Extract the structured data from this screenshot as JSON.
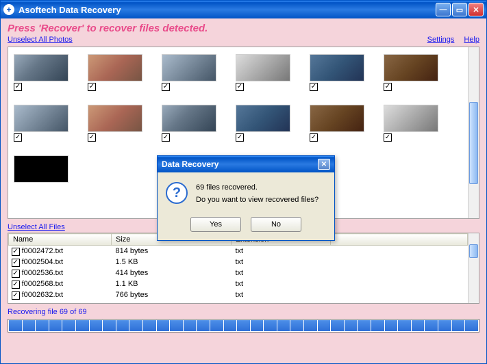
{
  "window": {
    "title": "Asoftech Data Recovery"
  },
  "instruction": "Press 'Recover' to recover files detected.",
  "links": {
    "unselect_photos": "Unselect All Photos",
    "settings": "Settings",
    "help": "Help",
    "unselect_files": "Unselect All Files"
  },
  "dialog": {
    "title": "Data Recovery",
    "line1": "69 files recovered.",
    "line2": "Do you want to view recovered files?",
    "yes": "Yes",
    "no": "No"
  },
  "file_table": {
    "cols": {
      "name": "Name",
      "size": "Size",
      "ext": "Extension"
    },
    "rows": [
      {
        "name": "f0002472.txt",
        "size": "814 bytes",
        "ext": "txt"
      },
      {
        "name": "f0002504.txt",
        "size": "1.5 KB",
        "ext": "txt"
      },
      {
        "name": "f0002536.txt",
        "size": "414 bytes",
        "ext": "txt"
      },
      {
        "name": "f0002568.txt",
        "size": "1.1 KB",
        "ext": "txt"
      },
      {
        "name": "f0002632.txt",
        "size": "766 bytes",
        "ext": "txt"
      }
    ]
  },
  "progress": {
    "label": "Recovering file 69 of 69"
  },
  "checkmark": "✓"
}
